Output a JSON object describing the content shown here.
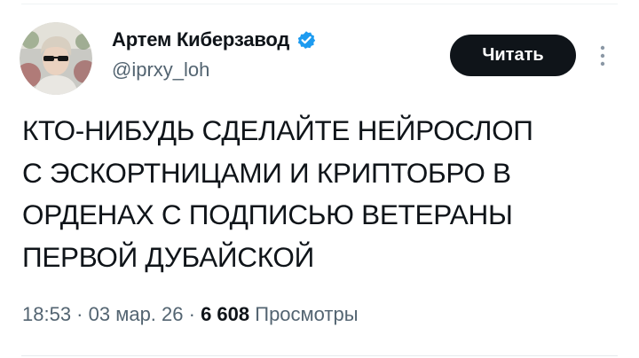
{
  "author": {
    "display_name": "Артем Киберзавод",
    "handle": "@iprxy_loh",
    "verified": true,
    "verified_color": "#1d9bf0"
  },
  "follow_button": {
    "label": "Читать",
    "background": "#0f1419"
  },
  "more_menu": {
    "icon": "more-vertical-icon"
  },
  "tweet": {
    "text_lines": [
      "КТО-НИБУДЬ СДЕЛАЙТЕ НЕЙРОСЛОП",
      "С ЭСКОРТНИЦАМИ И КРИПТОБРО В",
      "ОРДЕНАХ С ПОДПИСЬЮ ВЕТЕРАНЫ",
      "ПЕРВОЙ ДУБАЙСКОЙ"
    ]
  },
  "meta": {
    "time": "18:53",
    "separator": " · ",
    "date": "03 мар. 26",
    "views_count": "6 608",
    "views_label": "Просмотры"
  }
}
